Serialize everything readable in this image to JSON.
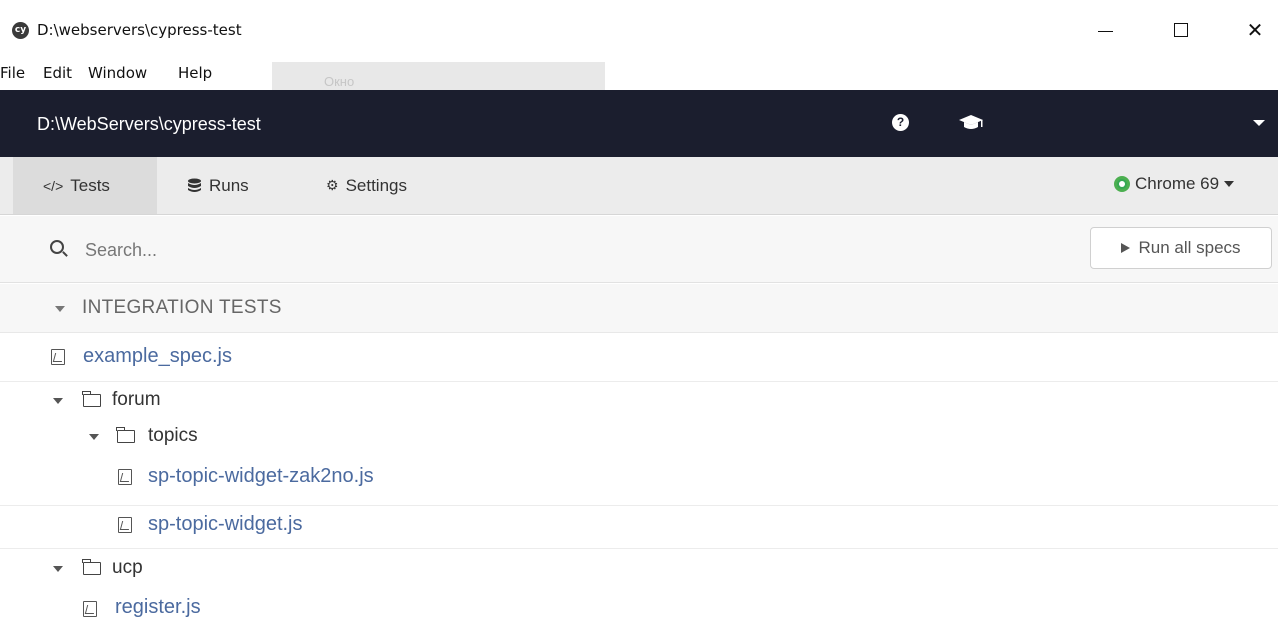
{
  "window": {
    "title": "D:\\webservers\\cypress-test",
    "app_icon_label": "cy"
  },
  "menu": {
    "items": [
      "File",
      "Edit",
      "Window",
      "Help"
    ],
    "tooltip": "Окно"
  },
  "header": {
    "project_path": "D:\\WebServers\\cypress-test",
    "help_icon": "?"
  },
  "nav": {
    "tabs": [
      {
        "label": "Tests",
        "icon": "</>",
        "active": true
      },
      {
        "label": "Runs",
        "icon": "database-icon",
        "active": false
      },
      {
        "label": "Settings",
        "icon": "gear-icon",
        "active": false
      }
    ],
    "browser": "Chrome 69"
  },
  "search": {
    "placeholder": "Search..."
  },
  "run_all_label": "Run all specs",
  "integration_label": "INTEGRATION TESTS",
  "files": {
    "example": "example_spec.js",
    "forum": "forum",
    "topics": "topics",
    "topic_widget_zak": "sp-topic-widget-zak2no.js",
    "topic_widget": "sp-topic-widget.js",
    "ucp": "ucp",
    "register": "register.js"
  },
  "colors": {
    "header_bg": "#1b1e2e",
    "link": "#4b6a9f",
    "nav_bg": "#ececec"
  }
}
